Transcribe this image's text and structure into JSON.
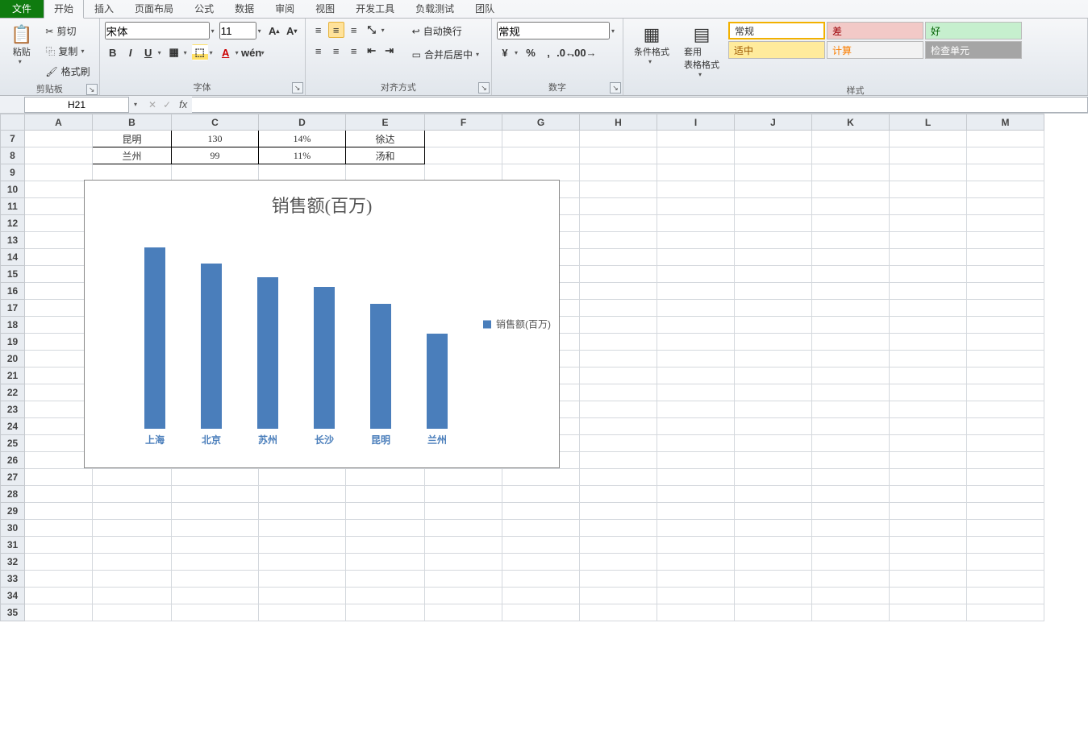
{
  "tabs": {
    "file": "文件",
    "list": [
      "开始",
      "插入",
      "页面布局",
      "公式",
      "数据",
      "审阅",
      "视图",
      "开发工具",
      "负载测试",
      "团队"
    ],
    "active": 0
  },
  "clipboard": {
    "paste": "粘贴",
    "cut": "剪切",
    "copy": "复制",
    "fmtPainter": "格式刷",
    "group": "剪贴板"
  },
  "font": {
    "name": "宋体",
    "size": "11",
    "group": "字体"
  },
  "align": {
    "wrap": "自动换行",
    "merge": "合并后居中",
    "group": "对齐方式"
  },
  "number": {
    "fmt": "常规",
    "group": "数字"
  },
  "styles": {
    "cond": "条件格式",
    "tbl": "套用\n表格格式",
    "normal": "常规",
    "bad": "差",
    "good": "好",
    "neutral": "适中",
    "calc": "计算",
    "check": "检查单元",
    "group": "样式"
  },
  "nameBox": "H21",
  "columns": [
    "A",
    "B",
    "C",
    "D",
    "E",
    "F",
    "G",
    "H",
    "I",
    "J",
    "K",
    "L",
    "M"
  ],
  "rowStart": 7,
  "rowEnd": 35,
  "table": {
    "rows": [
      {
        "r": 7,
        "b": "昆明",
        "c": "130",
        "d": "14%",
        "e": "徐达"
      },
      {
        "r": 8,
        "b": "兰州",
        "c": "99",
        "d": "11%",
        "e": "汤和"
      }
    ]
  },
  "chart_data": {
    "type": "bar",
    "title": "销售额(百万)",
    "categories": [
      "上海",
      "北京",
      "苏州",
      "长沙",
      "昆明",
      "兰州"
    ],
    "values": [
      189,
      172,
      158,
      148,
      130,
      99
    ],
    "series_name": "销售额(百万)",
    "ylim": [
      0,
      200
    ]
  }
}
